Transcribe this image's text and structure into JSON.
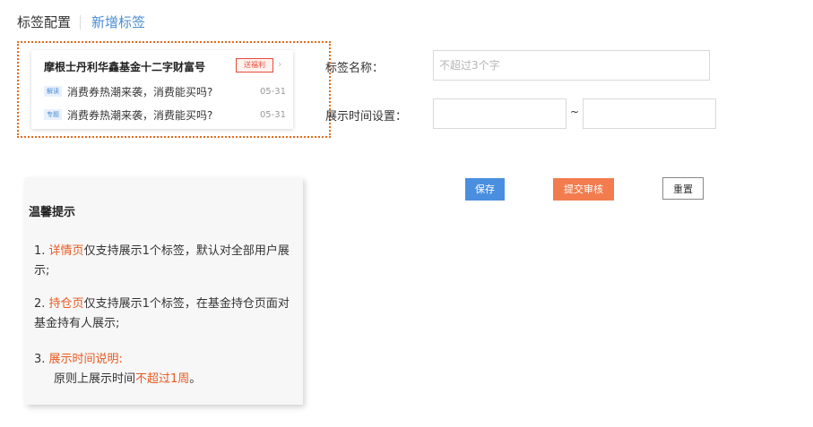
{
  "header": {
    "tab_config": "标签配置",
    "tab_add": "新增标签"
  },
  "preview": {
    "title": "摩根士丹利华鑫基金十二字财富号",
    "badge": "送福利",
    "arrow": "›",
    "rows": [
      {
        "tag": "解读",
        "text": "消费券热潮来袭，消费能买吗?",
        "date": "05-31"
      },
      {
        "tag": "专题",
        "text": "消费券热潮来袭，消费能买吗?",
        "date": "05-31"
      }
    ]
  },
  "form": {
    "name_label": "标签名称：",
    "name_placeholder": "不超过3个字",
    "name_value": "",
    "time_label": "展示时间设置：",
    "start_value": "",
    "end_value": "",
    "separator": "~"
  },
  "buttons": {
    "save": "保存",
    "submit": "提交审核",
    "reset": "重置"
  },
  "tips": {
    "title": "温馨提示",
    "items": [
      {
        "num": "1.",
        "hl": "详情页",
        "rest": "仅支持展示1个标签，默认对全部用户展示;"
      },
      {
        "num": "2.",
        "hl": "持仓页",
        "rest": "仅支持展示1个标签，在基金持仓页面对基金持有人展示;"
      },
      {
        "num": "3.",
        "hl": "展示时间说明:",
        "sub_pre": "原则上展示时间",
        "sub_hl": "不超过1周",
        "sub_post": "。"
      }
    ]
  },
  "colors": {
    "accent_blue": "#4a8fdf",
    "accent_orange": "#f27c4e",
    "highlight": "#e8591f",
    "preview_border": "#e26a1c"
  }
}
